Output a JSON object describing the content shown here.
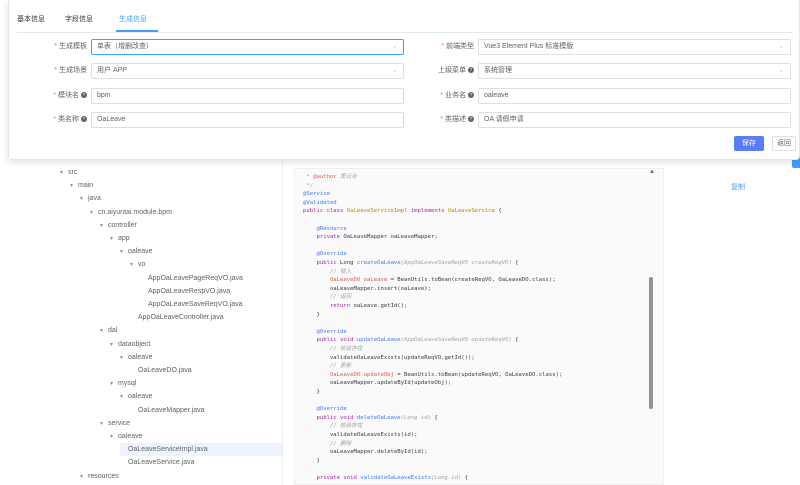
{
  "tabs": [
    "基本信息",
    "字段信息",
    "生成信息"
  ],
  "form": {
    "template": {
      "label": "生成模板",
      "value": "单表（增删改查）"
    },
    "frontend_type": {
      "label": "前端类型",
      "value": "Vue3 Element Plus 标准模版"
    },
    "scene": {
      "label": "生成场景",
      "value": "用户 APP"
    },
    "parent_menu": {
      "label": "上级菜单",
      "value": "系统管理"
    },
    "module_name": {
      "label": "模块名",
      "value": "bpm"
    },
    "business_name": {
      "label": "业务名",
      "value": "oaleave"
    },
    "class_name": {
      "label": "类名称",
      "value": "OaLeave"
    },
    "class_desc": {
      "label": "类描述",
      "value": "OA 请假申请"
    },
    "required_mark": "*",
    "help_glyph": "?"
  },
  "buttons": {
    "save": "保存",
    "back": "返回",
    "copy": "复制"
  },
  "tree": [
    {
      "label": "src",
      "expanded": true
    },
    {
      "label": "main",
      "expanded": true
    },
    {
      "label": "java",
      "expanded": true
    },
    {
      "label": "cn.aiyuntai.module.bpm",
      "expanded": true
    },
    {
      "label": "controller",
      "expanded": true
    },
    {
      "label": "app",
      "expanded": true
    },
    {
      "label": "oaleave",
      "expanded": true
    },
    {
      "label": "vo",
      "expanded": true
    },
    {
      "label": "AppOaLeavePageReqVO.java",
      "expanded": false
    },
    {
      "label": "AppOaLeaveRespVO.java",
      "expanded": false
    },
    {
      "label": "AppOaLeaveSaveReqVO.java",
      "expanded": false
    },
    {
      "label": "AppOaLeaveController.java",
      "expanded": false
    },
    {
      "label": "dal",
      "expanded": true
    },
    {
      "label": "dataobject",
      "expanded": true
    },
    {
      "label": "oaleave",
      "expanded": true
    },
    {
      "label": "OaLeaveDO.java",
      "expanded": false
    },
    {
      "label": "mysql",
      "expanded": true
    },
    {
      "label": "oaleave",
      "expanded": true
    },
    {
      "label": "OaLeaveMapper.java",
      "expanded": false
    },
    {
      "label": "service",
      "expanded": true
    },
    {
      "label": "oaleave",
      "expanded": true
    },
    {
      "label": "OaLeaveServiceImpl.java",
      "expanded": false,
      "selected": true
    },
    {
      "label": "OaLeaveService.java",
      "expanded": false
    },
    {
      "label": "resources",
      "expanded": true
    }
  ],
  "code": [
    [
      [
        "c-comment",
        " * "
      ],
      [
        "c-var",
        "@author"
      ],
      [
        "c-comment",
        " 爱云台"
      ]
    ],
    [
      [
        "c-comment",
        " */"
      ]
    ],
    [
      [
        "c-ann",
        "@Service"
      ]
    ],
    [
      [
        "c-ann",
        "@Validated"
      ]
    ],
    [
      [
        "c-kw",
        "public class "
      ],
      [
        "c-type",
        "OaLeaveServiceImpl"
      ],
      [
        "c-kw",
        " implements "
      ],
      [
        "c-type",
        "OaLeaveService"
      ],
      [
        "",
        " {"
      ]
    ],
    [
      [
        "",
        ""
      ]
    ],
    [
      [
        "c-ann",
        "    @Resource"
      ]
    ],
    [
      [
        "c-kw",
        "    private "
      ],
      [
        "",
        "OaLeaveMapper oaLeaveMapper;"
      ]
    ],
    [
      [
        "",
        ""
      ]
    ],
    [
      [
        "c-ann",
        "    @Override"
      ]
    ],
    [
      [
        "c-kw",
        "    public "
      ],
      [
        "",
        "Long "
      ],
      [
        "c-fn",
        "createOaLeave"
      ],
      [
        "c-comment",
        "(AppOaLeaveSaveReqVO createReqVO)"
      ],
      [
        "",
        " {"
      ]
    ],
    [
      [
        "c-comment",
        "        // 插入"
      ]
    ],
    [
      [
        "c-var",
        "        OaLeaveDO oaLeave"
      ],
      [
        "",
        " = BeanUtils.toBean(createReqVO, OaLeaveDO.class);"
      ]
    ],
    [
      [
        "",
        "        oaLeaveMapper.insert(oaLeave);"
      ]
    ],
    [
      [
        "c-comment",
        "        // 返回"
      ]
    ],
    [
      [
        "c-kw",
        "        return "
      ],
      [
        "",
        "oaLeave.getId();"
      ]
    ],
    [
      [
        "",
        "    }"
      ]
    ],
    [
      [
        "",
        ""
      ]
    ],
    [
      [
        "c-ann",
        "    @Override"
      ]
    ],
    [
      [
        "c-kw",
        "    public void "
      ],
      [
        "c-fn",
        "updateOaLeave"
      ],
      [
        "c-comment",
        "(AppOaLeaveSaveReqVO updateReqVO)"
      ],
      [
        "",
        " {"
      ]
    ],
    [
      [
        "c-comment",
        "        // 校验存在"
      ]
    ],
    [
      [
        "",
        "        validateOaLeaveExists(updateReqVO.getId());"
      ]
    ],
    [
      [
        "c-comment",
        "        // 更新"
      ]
    ],
    [
      [
        "c-var",
        "        OaLeaveDO updateObj"
      ],
      [
        "",
        " = BeanUtils.toBean(updateReqVO, OaLeaveDO.class);"
      ]
    ],
    [
      [
        "",
        "        oaLeaveMapper.updateById(updateObj);"
      ]
    ],
    [
      [
        "",
        "    }"
      ]
    ],
    [
      [
        "",
        ""
      ]
    ],
    [
      [
        "c-ann",
        "    @Override"
      ]
    ],
    [
      [
        "c-kw",
        "    public void "
      ],
      [
        "c-fn",
        "deleteOaLeave"
      ],
      [
        "c-comment",
        "(Long id)"
      ],
      [
        "",
        " {"
      ]
    ],
    [
      [
        "c-comment",
        "        // 校验存在"
      ]
    ],
    [
      [
        "",
        "        validateOaLeaveExists(id);"
      ]
    ],
    [
      [
        "c-comment",
        "        // 删除"
      ]
    ],
    [
      [
        "",
        "        oaLeaveMapper.deleteById(id);"
      ]
    ],
    [
      [
        "",
        "    }"
      ]
    ],
    [
      [
        "",
        ""
      ]
    ],
    [
      [
        "c-kw",
        "    private void "
      ],
      [
        "c-fn",
        "validateOaLeaveExists"
      ],
      [
        "c-comment",
        "(Long id)"
      ],
      [
        "",
        " {"
      ]
    ]
  ]
}
